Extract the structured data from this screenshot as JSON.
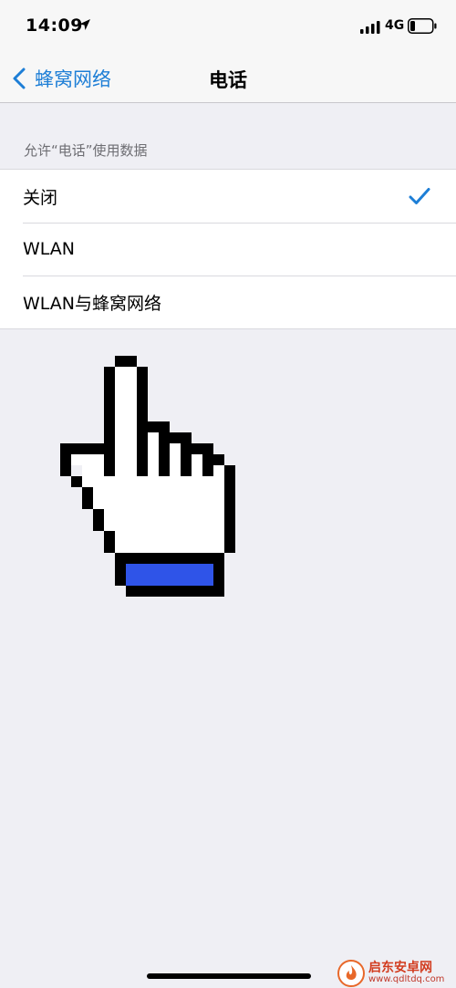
{
  "status_bar": {
    "time": "14:09",
    "network": "4G",
    "icons": [
      "location-arrow-icon",
      "signal-bars-icon",
      "battery-icon"
    ]
  },
  "nav": {
    "back_label": "蜂窝网络",
    "title": "电话",
    "accent_color": "#1d7ed6"
  },
  "section": {
    "header": "允许“电话”使用数据",
    "options": [
      {
        "label": "关闭",
        "selected": true
      },
      {
        "label": "WLAN",
        "selected": false
      },
      {
        "label": "WLAN与蜂窝网络",
        "selected": false
      }
    ]
  },
  "overlay": {
    "icon": "pointing-hand-cursor-icon",
    "cuff_color": "#2f54e8"
  },
  "watermark": {
    "main": "启东安卓网",
    "url": "www.qdltdq.com",
    "icon": "flame-logo-icon"
  }
}
